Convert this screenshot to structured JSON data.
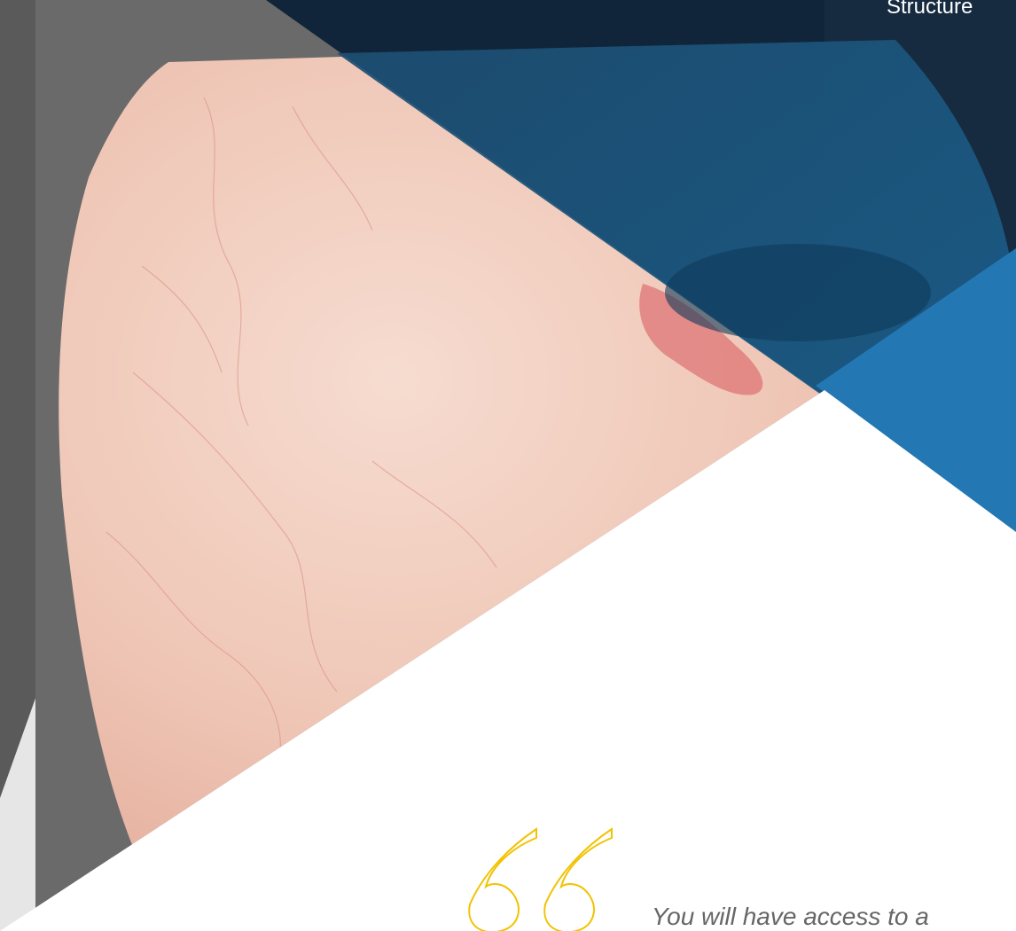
{
  "header": {
    "title": "Structure"
  },
  "quote": {
    "icon": "quote-icon",
    "text": "You will have access to a",
    "accent_color": "#f2c200"
  },
  "colors": {
    "dark_navy": "#0d2238",
    "mid_blue": "#1a5a82",
    "light_blue": "#2377b3",
    "gray_frame": "#6a6a6a"
  }
}
